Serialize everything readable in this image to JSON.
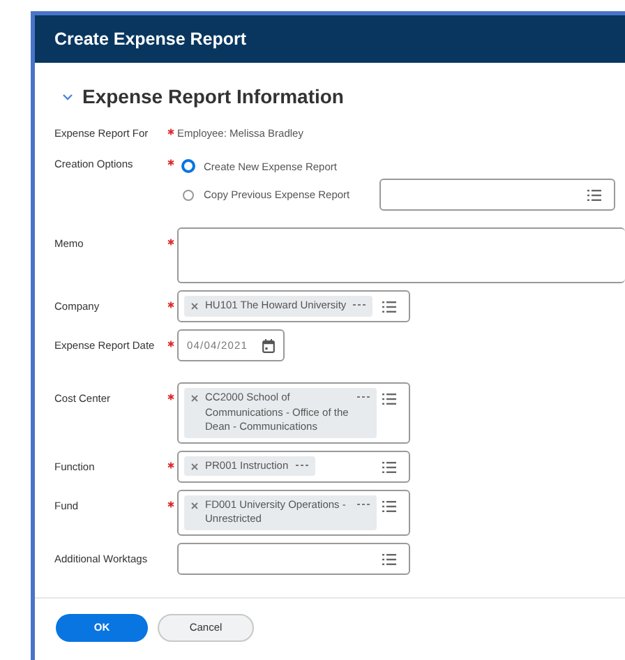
{
  "window": {
    "title": "Create Expense Report"
  },
  "section": {
    "title": "Expense Report Information",
    "expanded": true
  },
  "fields": [
    {
      "kind": "text",
      "label": "Expense Report For",
      "required": true,
      "value": "Employee: Melissa Bradley"
    },
    {
      "kind": "radio",
      "label": "Creation Options",
      "required": true,
      "options": [
        {
          "label": "Create New Expense Report",
          "selected": true,
          "has_prompt": false
        },
        {
          "label": "Copy Previous Expense Report",
          "selected": false,
          "has_prompt": true
        }
      ]
    },
    {
      "kind": "memo",
      "label": "Memo",
      "required": true
    },
    {
      "kind": "prompt",
      "label": "Company",
      "required": true,
      "tags": [
        "HU101 The Howard University"
      ]
    },
    {
      "kind": "date",
      "label": "Expense Report Date",
      "required": true,
      "value": "04/04/2021"
    },
    {
      "kind": "prompt",
      "label": "Cost Center",
      "required": true,
      "tags": [
        "CC2000 School of Communications - Office of the Dean - Communications"
      ]
    },
    {
      "kind": "prompt",
      "label": "Function",
      "required": true,
      "tags": [
        "PR001 Instruction"
      ]
    },
    {
      "kind": "prompt",
      "label": "Fund",
      "required": true,
      "tags": [
        "FD001 University Operations - Unrestricted"
      ]
    },
    {
      "kind": "prompt",
      "label": "Additional Worktags",
      "required": false
    }
  ],
  "buttons": [
    {
      "label": "OK",
      "primary": true
    },
    {
      "label": "Cancel",
      "primary": false
    }
  ]
}
